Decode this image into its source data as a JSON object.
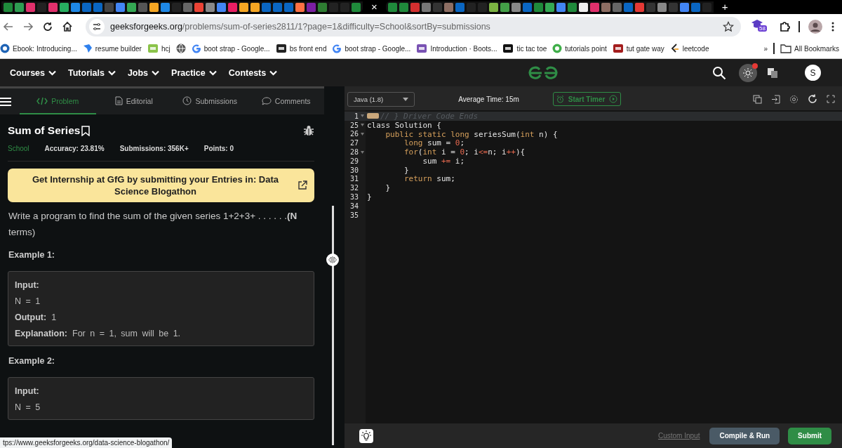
{
  "browser": {
    "close_tab": "×",
    "new_tab": "+",
    "url": {
      "host": "geeksforgeeks.org",
      "path": "/problems/sum-of-series2811/1?page=1&difficulty=School&sortBy=submissions"
    },
    "extension_badge": "58",
    "bookmarks": [
      {
        "kind": "circle",
        "label": "Ebook: Introducing..."
      },
      {
        "kind": "resume",
        "label": "resume builder"
      },
      {
        "kind": "code",
        "label": "hcj"
      },
      {
        "kind": "globe"
      },
      {
        "kind": "google",
        "label": "boot strap - Google..."
      },
      {
        "kind": "wiki",
        "label": "bs front end"
      },
      {
        "kind": "google",
        "label": "boot strap - Google..."
      },
      {
        "kind": "bootstrap",
        "label": "Introduction · Boots..."
      },
      {
        "kind": "dev",
        "label": "tic tac toe"
      },
      {
        "kind": "tp",
        "label": "tutorials point"
      },
      {
        "kind": "tg",
        "label": "tut gate way"
      },
      {
        "kind": "leetcode",
        "label": "leetcode"
      }
    ],
    "more": "»",
    "all_bookmarks": "All Bookmarks"
  },
  "site_nav": {
    "menus": [
      "Courses",
      "Tutorials",
      "Jobs",
      "Practice",
      "Contests"
    ],
    "avatar": "S"
  },
  "problem_tabs": [
    {
      "kind": "code",
      "label": "Problem",
      "selected": true
    },
    {
      "kind": "doc",
      "label": "Editorial",
      "selected": false
    },
    {
      "kind": "clock",
      "label": "Submissions",
      "selected": false
    },
    {
      "kind": "chat",
      "label": "Comments",
      "selected": false
    }
  ],
  "problem": {
    "title": "Sum of Series",
    "difficulty": "School",
    "accuracy": "Accuracy: 23.81%",
    "submissions": "Submissions: 356K+",
    "points": "Points: 0",
    "banner": "Get Internship at GfG by submitting your Entries in: Data Science Blogathon",
    "statement": "Write a program to find the sum of the given series 1+2+3+ . . . . . .**(N** terms)",
    "examples": [
      {
        "heading": "Example 1:",
        "lines": [
          {
            "label": "Input:"
          },
          {
            "value": "N = 1"
          },
          {
            "label": "Output:",
            "value": "1"
          },
          {
            "label": "Explanation:",
            "value": "For n = 1, sum will be 1."
          }
        ]
      },
      {
        "heading": "Example 2:",
        "lines": [
          {
            "label": "Input:"
          },
          {
            "value": "N = 5"
          }
        ]
      }
    ]
  },
  "status_url": "tps://www.geeksforgeeks.org/data-science-blogathon/",
  "editor": {
    "language": "Java (1.8)",
    "average_time": "Average Time: 15m",
    "timer": "Start Timer",
    "lines": [
      {
        "number": "1",
        "fold": true,
        "highlighted": true,
        "folded_marker": true,
        "tokens": [
          {
            "kind": "comment",
            "text": "// } Driver Code Ends"
          }
        ]
      },
      {
        "number": "25",
        "fold": true,
        "highlighted": false,
        "folded_marker": false,
        "tokens": [
          {
            "kind": "plain",
            "text": "class Solution {"
          }
        ]
      },
      {
        "number": "26",
        "fold": true,
        "highlighted": false,
        "folded_marker": false,
        "tokens": [
          {
            "kind": "keyword",
            "text": "    public static long"
          },
          {
            "kind": "plain",
            "text": " seriesSum("
          },
          {
            "kind": "keyword",
            "text": "int"
          },
          {
            "kind": "plain",
            "text": " n) {"
          }
        ]
      },
      {
        "number": "27",
        "fold": false,
        "highlighted": false,
        "folded_marker": false,
        "tokens": [
          {
            "kind": "keyword",
            "text": "        long"
          },
          {
            "kind": "plain",
            "text": " sum = "
          },
          {
            "kind": "number",
            "text": "0"
          },
          {
            "kind": "plain",
            "text": ";"
          }
        ]
      },
      {
        "number": "28",
        "fold": true,
        "highlighted": false,
        "folded_marker": false,
        "tokens": [
          {
            "kind": "keyword",
            "text": "        for"
          },
          {
            "kind": "plain",
            "text": "("
          },
          {
            "kind": "keyword",
            "text": "int"
          },
          {
            "kind": "plain",
            "text": " i = "
          },
          {
            "kind": "number",
            "text": "0"
          },
          {
            "kind": "plain",
            "text": "; i"
          },
          {
            "kind": "operator",
            "text": "<="
          },
          {
            "kind": "plain",
            "text": "n; i"
          },
          {
            "kind": "operator",
            "text": "++"
          },
          {
            "kind": "plain",
            "text": "){"
          }
        ]
      },
      {
        "number": "29",
        "fold": false,
        "highlighted": false,
        "folded_marker": false,
        "tokens": [
          {
            "kind": "plain",
            "text": "            sum "
          },
          {
            "kind": "operator",
            "text": "+="
          },
          {
            "kind": "plain",
            "text": " i;"
          }
        ]
      },
      {
        "number": "30",
        "fold": false,
        "highlighted": false,
        "folded_marker": false,
        "tokens": [
          {
            "kind": "plain",
            "text": "        }"
          }
        ]
      },
      {
        "number": "31",
        "fold": false,
        "highlighted": false,
        "folded_marker": false,
        "tokens": [
          {
            "kind": "keyword",
            "text": "        return"
          },
          {
            "kind": "plain",
            "text": " sum;"
          }
        ]
      },
      {
        "number": "32",
        "fold": false,
        "highlighted": false,
        "folded_marker": false,
        "tokens": [
          {
            "kind": "plain",
            "text": "    }"
          }
        ]
      },
      {
        "number": "33",
        "fold": false,
        "highlighted": false,
        "folded_marker": false,
        "tokens": [
          {
            "kind": "plain",
            "text": "}"
          }
        ]
      },
      {
        "number": "34",
        "fold": false,
        "highlighted": false,
        "folded_marker": false
      },
      {
        "number": "35",
        "fold": false,
        "highlighted": false,
        "folded_marker": false
      }
    ],
    "custom_input": "Custom Input",
    "compile": "Compile & Run",
    "submit": "Submit"
  }
}
